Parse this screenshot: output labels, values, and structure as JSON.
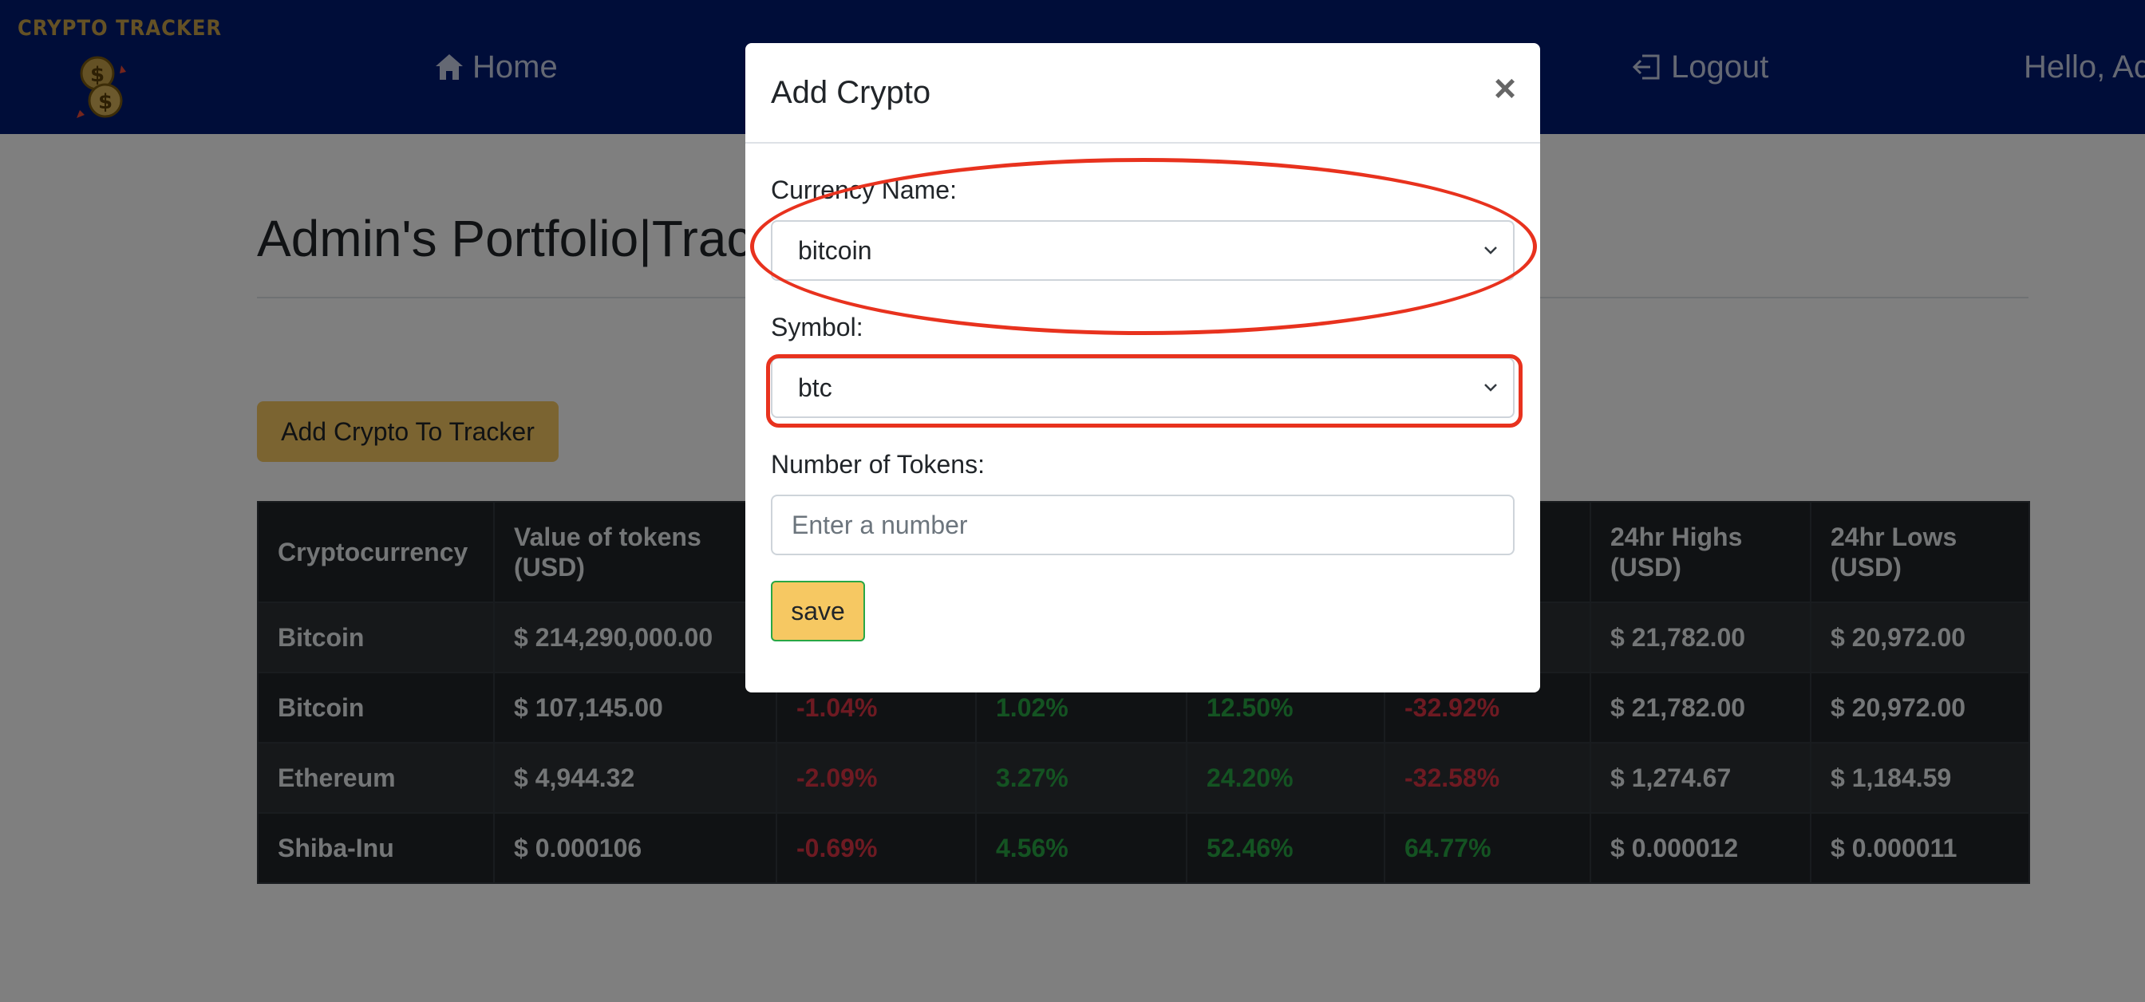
{
  "navbar": {
    "brand_text": "CRYPTO TRACKER",
    "home_label": "Home",
    "logout_label": "Logout",
    "greeting": "Hello, Ac",
    "bg_color": "#001a73"
  },
  "page": {
    "title": "Admin's Portfolio|Trac",
    "add_button_label": "Add Crypto To Tracker"
  },
  "table": {
    "headers": [
      "Cryptocurrency",
      "Value of tokens (USD)",
      "",
      "",
      "",
      "",
      "24hr Highs (USD)",
      "24hr Lows (USD)"
    ],
    "rows": [
      [
        "Bitcoin",
        "$ 214,290,000.00",
        "",
        "",
        "",
        "",
        "$ 21,782.00",
        "$ 20,972.00"
      ],
      [
        "Bitcoin",
        "$ 107,145.00",
        "-1.04%",
        "1.02%",
        "12.50%",
        "-32.92%",
        "$ 21,782.00",
        "$ 20,972.00"
      ],
      [
        "Ethereum",
        "$ 4,944.32",
        "-2.09%",
        "3.27%",
        "24.20%",
        "-32.58%",
        "$ 1,274.67",
        "$ 1,184.59"
      ],
      [
        "Shiba-Inu",
        "$ 0.000106",
        "-0.69%",
        "4.56%",
        "52.46%",
        "64.77%",
        "$ 0.000012",
        "$ 0.000011"
      ]
    ]
  },
  "modal": {
    "title": "Add Crypto",
    "close_glyph": "×",
    "currency_label": "Currency Name:",
    "currency_value": "bitcoin",
    "symbol_label": "Symbol:",
    "symbol_value": "btc",
    "tokens_label": "Number of Tokens:",
    "tokens_placeholder": "Enter a number",
    "save_label": "save"
  },
  "colors": {
    "accent": "#f6c862",
    "positive": "#28a745",
    "negative": "#dc3545",
    "annotation": "#e8321e"
  }
}
